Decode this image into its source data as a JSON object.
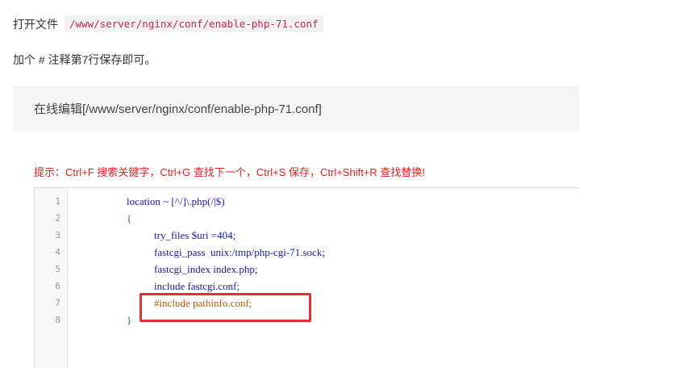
{
  "instructions": {
    "open_file_label": "打开文件",
    "file_path": "/www/server/nginx/conf/enable-php-71.conf",
    "step_text": "加个 # 注释第7行保存即可。"
  },
  "editor": {
    "title": "在线编辑[/www/server/nginx/conf/enable-php-71.conf]",
    "tip": "提示：Ctrl+F 搜索关键字，Ctrl+G 查找下一个，Ctrl+S 保存，Ctrl+Shift+R 查找替换!",
    "line_numbers": [
      "1",
      "2",
      "3",
      "4",
      "5",
      "6",
      "7",
      "8"
    ],
    "lines": [
      "location ~ [^/]\\.php(/|$)",
      "{",
      "try_files $uri =404;",
      "fastcgi_pass  unix:/tmp/php-cgi-71.sock;",
      "fastcgi_index index.php;",
      "include fastcgi.conf;",
      "#include pathinfo.conf;",
      "}"
    ]
  },
  "colors": {
    "tip_red": "#e02020",
    "highlight_red": "#e03030",
    "path_code": "#c7254e"
  }
}
